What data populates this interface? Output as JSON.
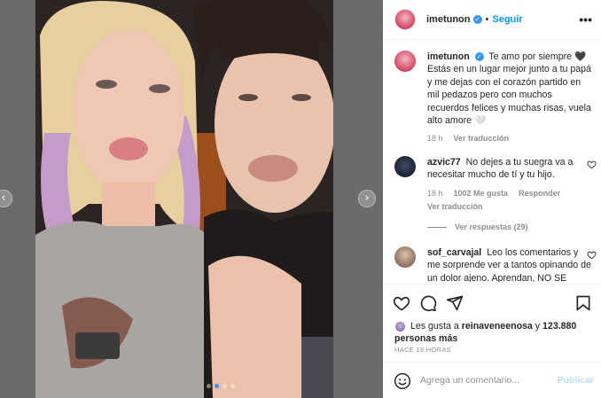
{
  "header": {
    "username": "imetunon",
    "separator": "•",
    "follow_label": "Seguir",
    "more_label": "•••"
  },
  "caption": {
    "username": "imetunon",
    "text": "Te amo por siempre 🖤 Estás en un lugar mejor junto a tu papá y me dejas con el corazón partido en mil pedazos pero con muchos recuerdos felices y muchas risas, vuela alto amore 🤍",
    "time": "18 h",
    "translate": "Ver traducción"
  },
  "comments": [
    {
      "username": "azvic77",
      "text": "No dejes a tu suegra va a necesitar mucho de tí y tu hijo.",
      "time": "18 h",
      "likes": "1002 Me gusta",
      "reply": "Responder",
      "translate": "Ver traducción",
      "view_replies": "Ver respuestas (29)"
    },
    {
      "username": "sof_carvajal",
      "text": "Leo los comentarios y me sorprende ver a tantos opinando de un dolor ajeno. Aprendan, NO SE"
    }
  ],
  "likes": {
    "prefix": "Les gusta a",
    "user": "reinaveneenosa",
    "middle": "y",
    "count": "123.880",
    "suffix": "personas más"
  },
  "timestamp": "HACE 18 HORAS",
  "add_comment": {
    "placeholder": "Agrega un comentario...",
    "publish_label": "Publicar"
  },
  "carousel": {
    "prev_icon": "‹",
    "next_icon": "›",
    "slide_count": 4,
    "active_slide": 2
  },
  "colors": {
    "accent": "#0095f6",
    "verified": "#3897f0",
    "publish_disabled": "#b2dffc",
    "muted": "#8e8e8e"
  }
}
